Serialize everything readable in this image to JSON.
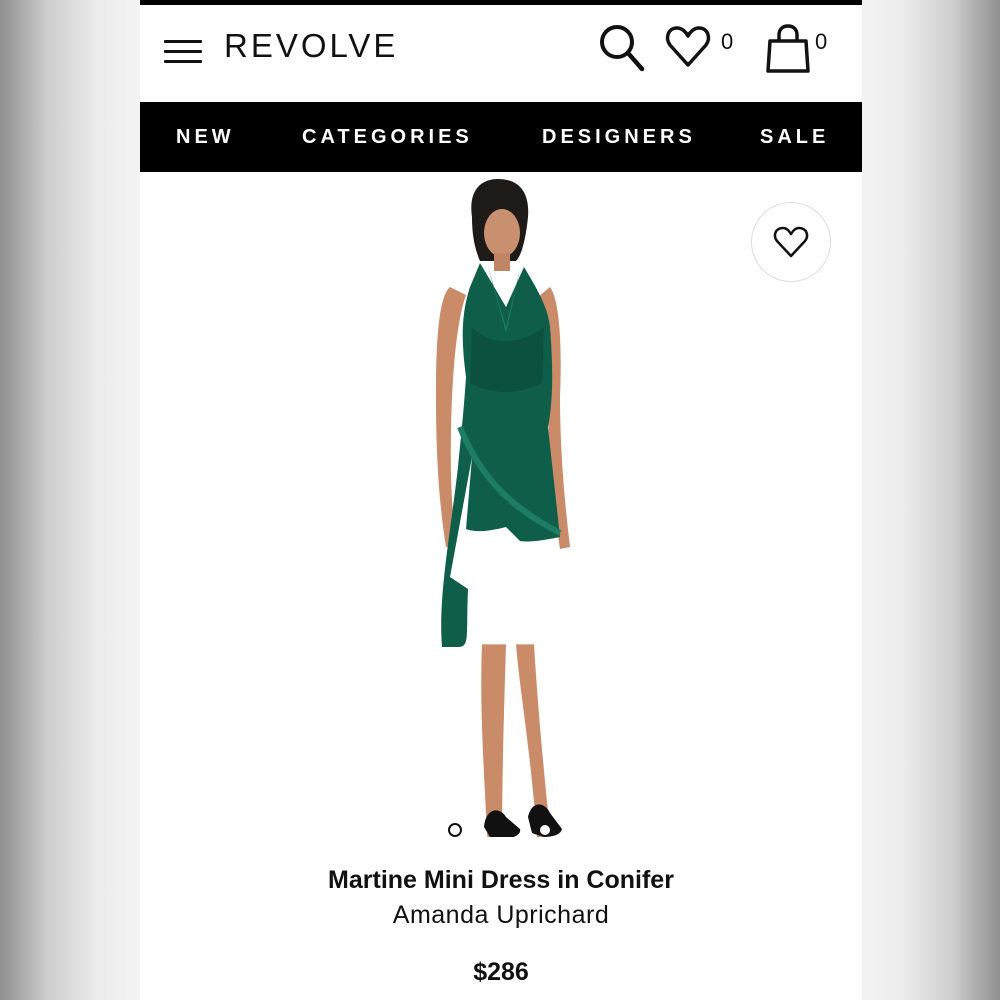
{
  "header": {
    "logo": "REVOLVE",
    "wishlist_count": "0",
    "bag_count": "0",
    "icons": [
      "menu-icon",
      "search-icon",
      "heart-icon",
      "bag-icon"
    ]
  },
  "nav": {
    "items": [
      "NEW",
      "CATEGORIES",
      "DESIGNERS",
      "SALE"
    ]
  },
  "product": {
    "name": "Martine Mini Dress in Conifer",
    "designer": "Amanda Uprichard",
    "price": "$286",
    "dress_color": "#0f5e4a",
    "image_count": 2
  }
}
